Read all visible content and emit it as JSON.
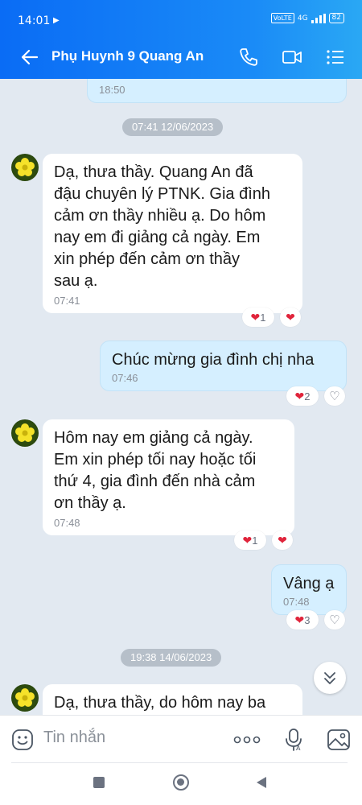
{
  "status": {
    "time": "14:01",
    "network": "4G",
    "volte": "VoLTE",
    "battery": "82"
  },
  "header": {
    "title": "Phụ Huynh 9 Quang An"
  },
  "messages": {
    "prev_time": "18:50",
    "date1": "07:41 12/06/2023",
    "m1_line1": "Dạ, thưa thầy. Quang An đã",
    "m1_line2": "đậu chuyên lý PTNK. Gia đình",
    "m1_line3": "cảm ơn thầy nhiều ạ. Do hôm",
    "m1_line4": "nay em đi giảng cả ngày. Em",
    "m1_line5": "xin phép đến cảm ơn thầy",
    "m1_line6": "sau ạ.",
    "m1_time": "07:41",
    "m1_react_count": "1",
    "m2_text": "Chúc mừng gia đình chị nha",
    "m2_time": "07:46",
    "m2_react_count": "2",
    "m3_line1": "Hôm nay em giảng cả ngày.",
    "m3_line2": "Em xin phép tối nay hoặc tối",
    "m3_line3": "thứ 4, gia đình đến nhà cảm",
    "m3_line4": "ơn thầy ạ.",
    "m3_time": "07:48",
    "m3_react_count": "1",
    "m4_text": "Vâng ạ",
    "m4_time": "07:48",
    "m4_react_count": "3",
    "date2": "19:38 14/06/2023",
    "m5_text": "Dạ, thưa thầy, do hôm nay ba"
  },
  "input": {
    "placeholder": "Tin nhắn"
  },
  "colors": {
    "accent": "#1a8bf7",
    "heart": "#e0243b",
    "outgoing": "#d5efff"
  }
}
